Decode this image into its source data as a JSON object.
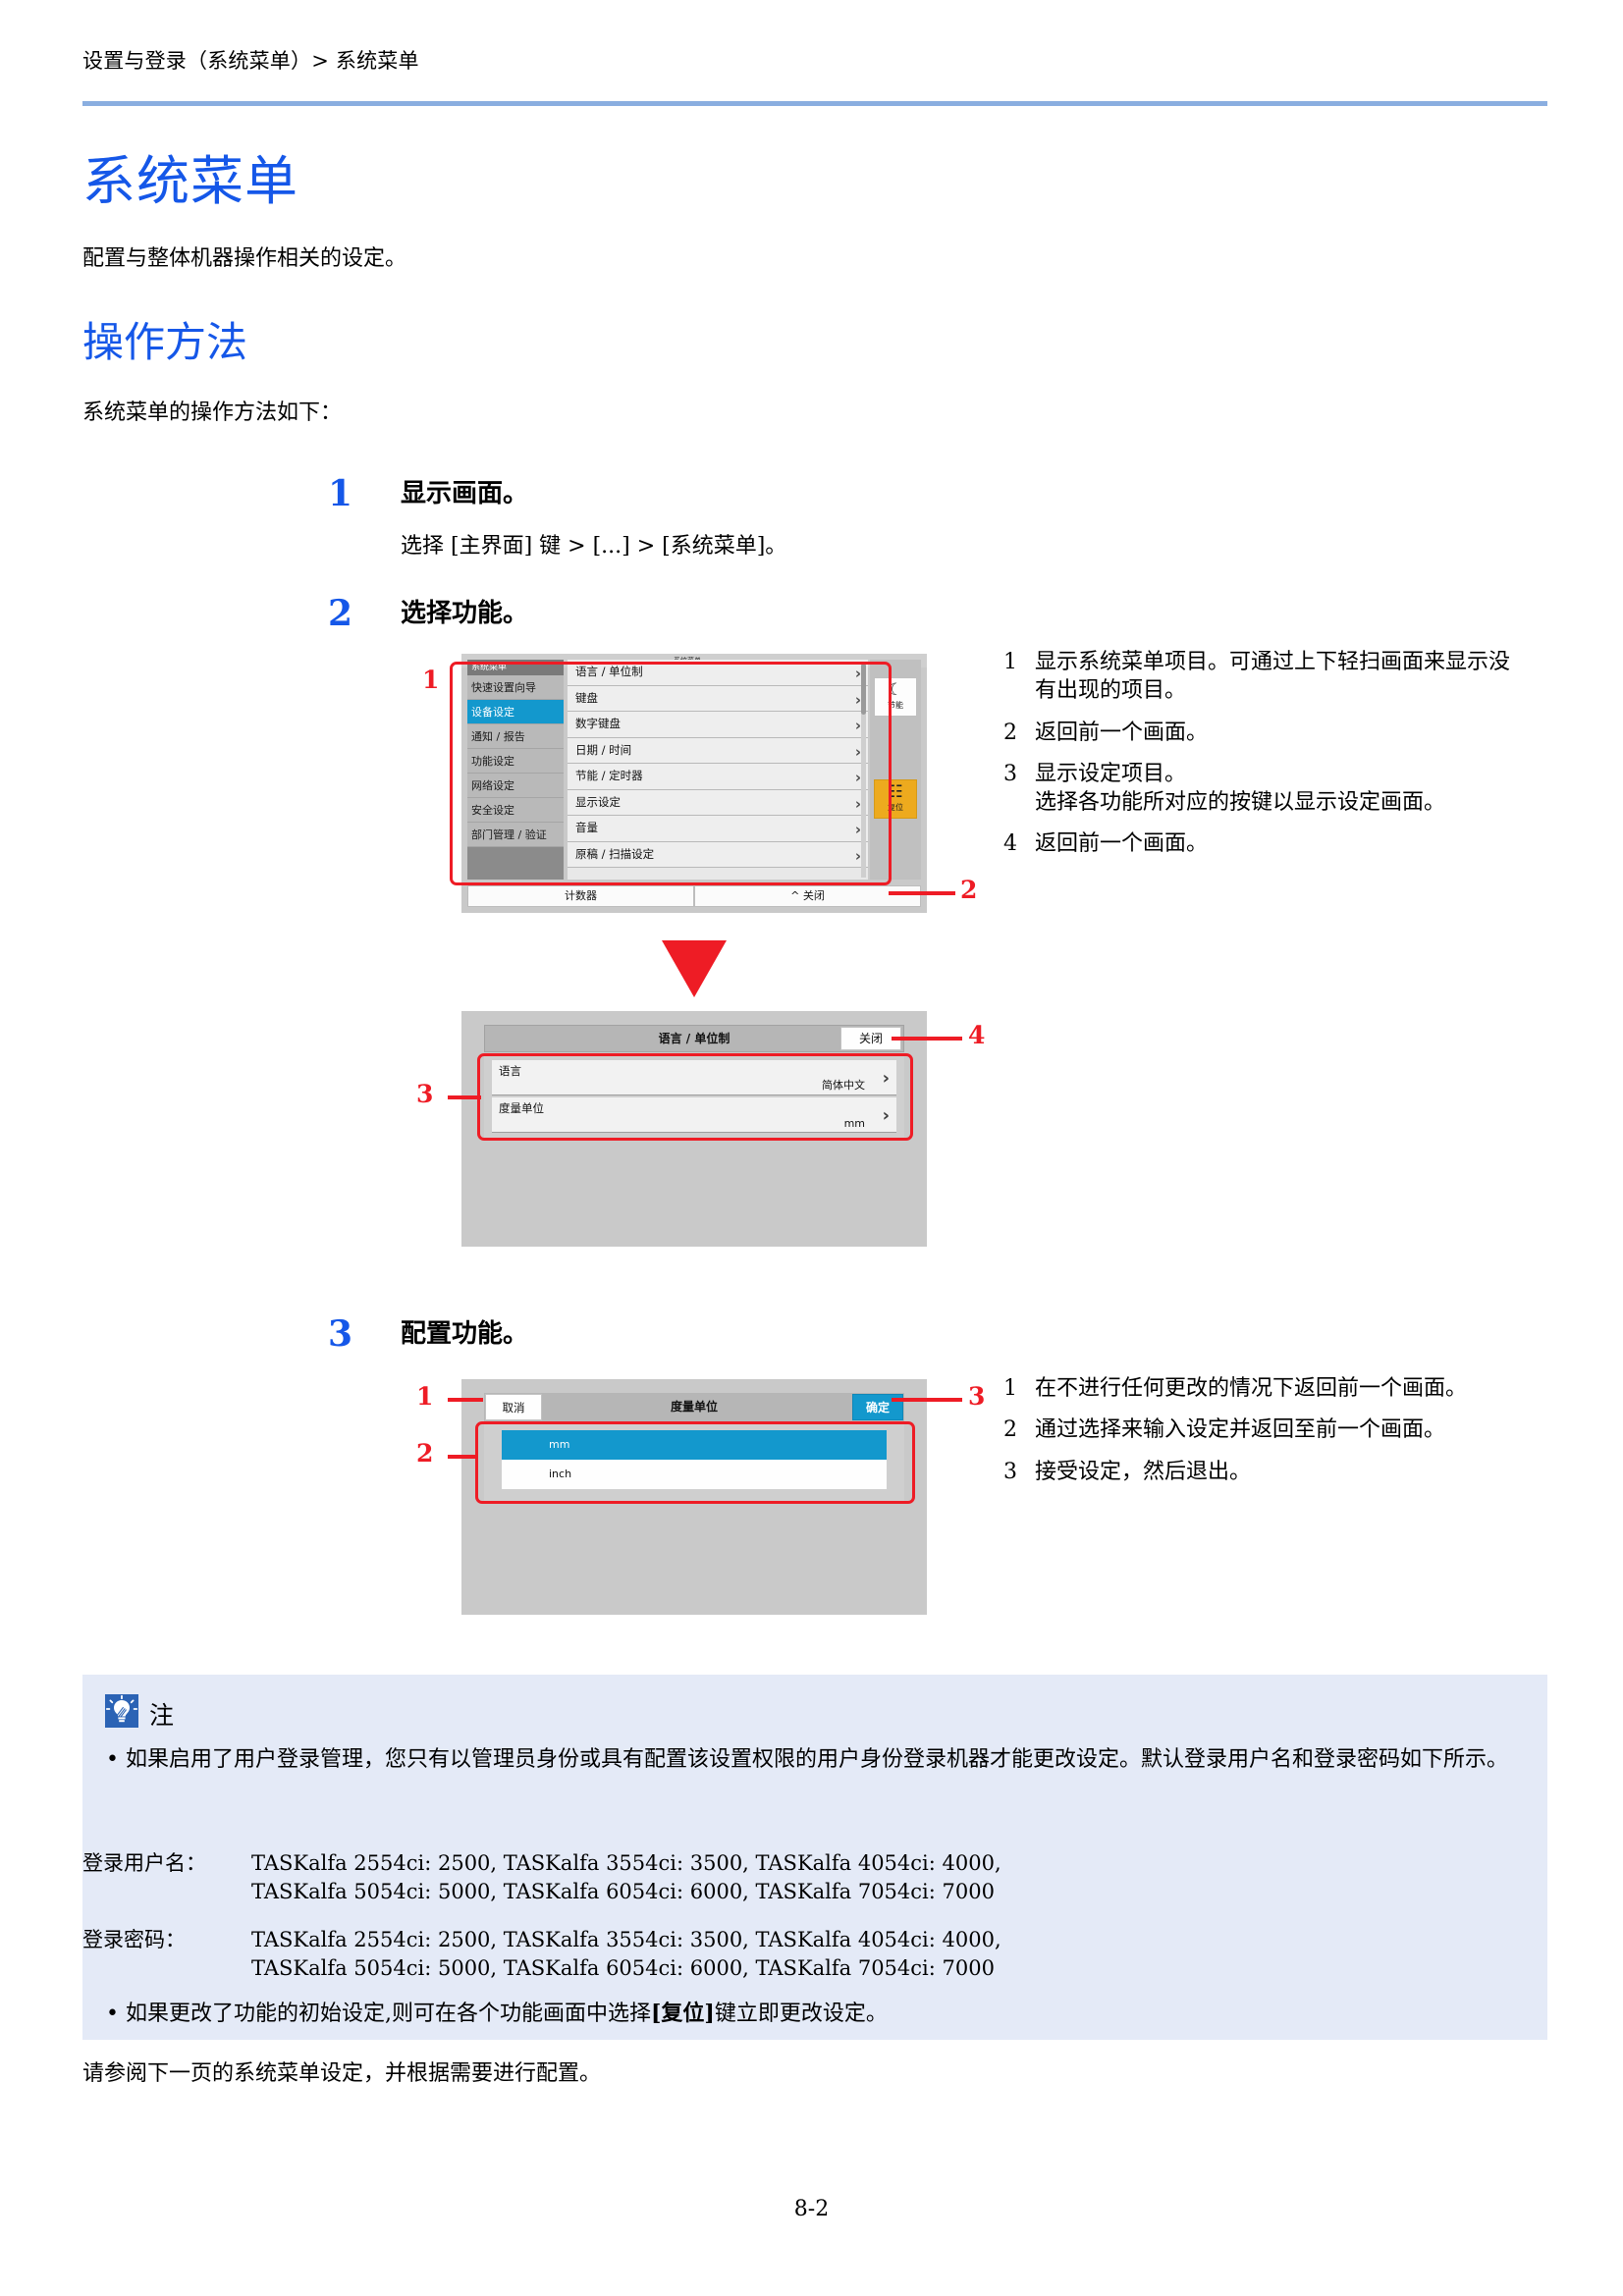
{
  "header": {
    "breadcrumb": "设置与登录（系统菜单）> 系统菜单"
  },
  "title": "系统菜单",
  "intro": "配置与整体机器操作相关的设定。",
  "section": {
    "heading": "操作方法",
    "lead": "系统菜单的操作方法如下："
  },
  "steps": [
    {
      "number": "1",
      "title": "显示画面。",
      "body": "选择 [主界面] 键 > [...] > [系统菜单]。"
    },
    {
      "number": "2",
      "title": "选择功能。"
    },
    {
      "number": "3",
      "title": "配置功能。"
    }
  ],
  "screen1": {
    "menu_header": "系统菜单",
    "sidebar": [
      "快速设置向导",
      "设备设定",
      "通知 / 报告",
      "功能设定",
      "网络设定",
      "安全设定",
      "部门管理 / 验证"
    ],
    "selected_sidebar": "设备设定",
    "list": [
      "语言 / 单位制",
      "键盘",
      "数字键盘",
      "日期 / 时间",
      "节能 / 定时器",
      "显示设定",
      "音量",
      "原稿 / 扫描设定"
    ],
    "hardkeys": [
      {
        "icon": "moon-icon",
        "label": "节能"
      },
      {
        "icon": "reset-icon",
        "label": "复位"
      }
    ],
    "footer": [
      "计数器",
      "关闭"
    ],
    "callouts": [
      "1",
      "2"
    ]
  },
  "screen1_notes": [
    {
      "idx": "1",
      "text": "显示系统菜单项目。可通过上下轻扫画面来显示没有出现的项目。"
    },
    {
      "idx": "2",
      "text": "返回前一个画面。"
    },
    {
      "idx": "3",
      "text": "显示设定项目。\n选择各功能所对应的按键以显示设定画面。"
    },
    {
      "idx": "4",
      "text": "返回前一个画面。"
    }
  ],
  "screen2": {
    "title": "语言 / 单位制",
    "close_label": "关闭",
    "rows": [
      {
        "label": "语言",
        "value": "简体中文"
      },
      {
        "label": "度量单位",
        "value": "mm"
      }
    ],
    "callouts": [
      "3",
      "4"
    ]
  },
  "screen3": {
    "title": "度量单位",
    "cancel_label": "取消",
    "ok_label": "确定",
    "options": [
      {
        "label": "mm",
        "selected": true
      },
      {
        "label": "inch",
        "selected": false
      }
    ],
    "callouts": [
      "1",
      "2",
      "3"
    ]
  },
  "screen3_notes": [
    {
      "idx": "1",
      "text": "在不进行任何更改的情况下返回前一个画面。"
    },
    {
      "idx": "2",
      "text": "通过选择来输入设定并返回至前一个画面。"
    },
    {
      "idx": "3",
      "text": "接受设定，然后退出。"
    }
  ],
  "note": {
    "icon": "note-lightbulb-icon",
    "title": "注",
    "bullet1": "如果启用了用户登录管理，您只有以管理员身份或具有配置该设置权限的用户身份登录机器才能更改设定。默认登录用户名和登录密码如下所示。",
    "username_label": "登录用户名：",
    "username_line1": "TASKalfa 2554ci: 2500, TASKalfa 3554ci: 3500, TASKalfa 4054ci: 4000,",
    "username_line2": "TASKalfa 5054ci: 5000, TASKalfa 6054ci: 6000, TASKalfa 7054ci: 7000",
    "password_label": "登录密码：",
    "password_line1": "TASKalfa 2554ci: 2500, TASKalfa 3554ci: 3500, TASKalfa 4054ci: 4000,",
    "password_line2": "TASKalfa 5054ci: 5000, TASKalfa 6054ci: 6000, TASKalfa 7054ci: 7000",
    "bullet2_pre": "如果更改了功能的初始设定,则可在各个功能画面中选择",
    "bullet2_key": "[复位]",
    "bullet2_post": "键立即更改设定。"
  },
  "closing": "请参阅下一页的系统菜单设定，并根据需要进行配置。",
  "page_number": "8-2",
  "colors": {
    "accent_blue": "#1557e8",
    "rule_blue": "#8aaee0",
    "callout_red": "#ee1c25",
    "ui_select_blue": "#1398cd",
    "reset_orange": "#edaa1e",
    "note_bg": "#e4eaf7",
    "note_icon_blue": "#2b63b5"
  }
}
